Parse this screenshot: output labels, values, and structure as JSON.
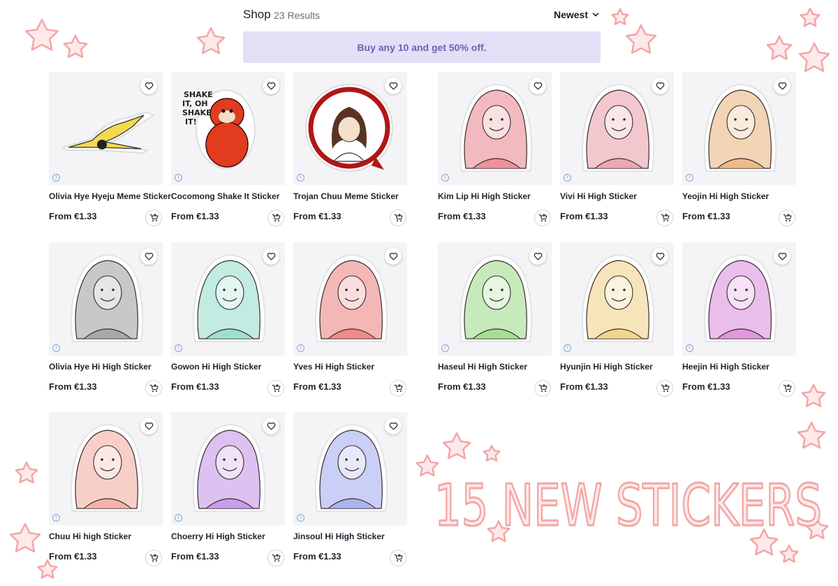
{
  "header": {
    "title": "Shop",
    "results": "23 Results",
    "sort_label": "Newest"
  },
  "promo": {
    "text": "Buy any 10 and get 50% off."
  },
  "products": [
    {
      "name": "Olivia Hye Hyeju Meme Sticker",
      "price": "From €1.33"
    },
    {
      "name": "Cocomong Shake It Sticker",
      "price": "From €1.33"
    },
    {
      "name": "Trojan Chuu Meme Sticker",
      "price": "From €1.33"
    },
    {
      "name": "Kim Lip Hi High Sticker",
      "price": "From €1.33"
    },
    {
      "name": "Vivi Hi High Sticker",
      "price": "From €1.33"
    },
    {
      "name": "Yeojin Hi High Sticker",
      "price": "From €1.33"
    },
    {
      "name": "Olivia Hye Hi High Sticker",
      "price": "From €1.33"
    },
    {
      "name": "Gowon Hi High Sticker",
      "price": "From €1.33"
    },
    {
      "name": "Yves Hi High Sticker",
      "price": "From €1.33"
    },
    {
      "name": "Haseul Hi High Sticker",
      "price": "From €1.33"
    },
    {
      "name": "Hyunjin Hi High Sticker",
      "price": "From €1.33"
    },
    {
      "name": "Heejin Hi High Sticker",
      "price": "From €1.33"
    },
    {
      "name": "Chuu Hi high Sticker",
      "price": "From €1.33"
    },
    {
      "name": "Choerry Hi High Sticker",
      "price": "From €1.33"
    },
    {
      "name": "Jinsoul Hi High Sticker",
      "price": "From €1.33"
    }
  ],
  "sticker_colors": [
    "#f4d94e",
    "#e23b1e",
    "#b01616",
    "#e8828a",
    "#e89aa6",
    "#e8b07a",
    "#9a9a9a",
    "#8fdcc8",
    "#ea7b78",
    "#98d985",
    "#eed080",
    "#d889d9",
    "#f1a89a",
    "#c08ee6",
    "#9ea7ee"
  ],
  "sticker_text": {
    "cocomong": "SHAKE IT, OH SHAKE IT!"
  },
  "decoration": {
    "banner": "15 NEW STICKERS",
    "accent_color": "#f3a6a6"
  },
  "icons": {
    "favorite": "heart-outline-icon",
    "cart": "add-to-cart-icon",
    "info": "info-icon",
    "sort": "chevron-down-icon"
  }
}
